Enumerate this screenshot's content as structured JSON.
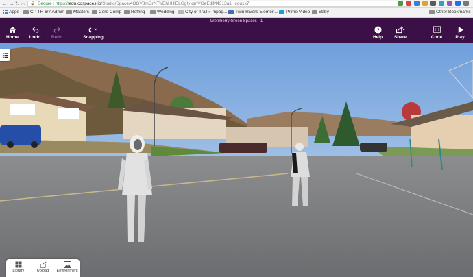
{
  "browser": {
    "back": "←",
    "forward": "→",
    "reload": "↻",
    "home": "⌂",
    "lock": "🔒",
    "secure_label": "Secure",
    "url_scheme": "https://",
    "url_host": "edu.cospaces.io",
    "url_path": "/Studio/Space/4OGV8mGrNTwEhHHlELGgIy;qmVGeEdiM4313a1Hcou1k7"
  },
  "bookmarks": {
    "items": [
      {
        "label": "Apps"
      },
      {
        "label": "CP TR 6/7 Admin"
      },
      {
        "label": "Masters"
      },
      {
        "label": "Core Comp"
      },
      {
        "label": "Reffing"
      },
      {
        "label": "Wedding"
      },
      {
        "label": "City of Trail » mpag..."
      },
      {
        "label": "Twin Rivers Elemen..."
      },
      {
        "label": "Prime Video"
      },
      {
        "label": "Baby"
      }
    ],
    "other": "Other Bookmarks"
  },
  "toolbar": {
    "title": "Glenmerry Green Spaces - 1",
    "home": "Home",
    "undo": "Undo",
    "redo": "Redo",
    "snapping": "Snapping",
    "help": "Help",
    "share": "Share",
    "code": "Code",
    "play": "Play"
  },
  "bottom_panel": {
    "library": "Library",
    "upload": "Upload",
    "environment": "Environment"
  },
  "colors": {
    "toolbar": "#3a1046",
    "secure": "#2b8a3e"
  }
}
